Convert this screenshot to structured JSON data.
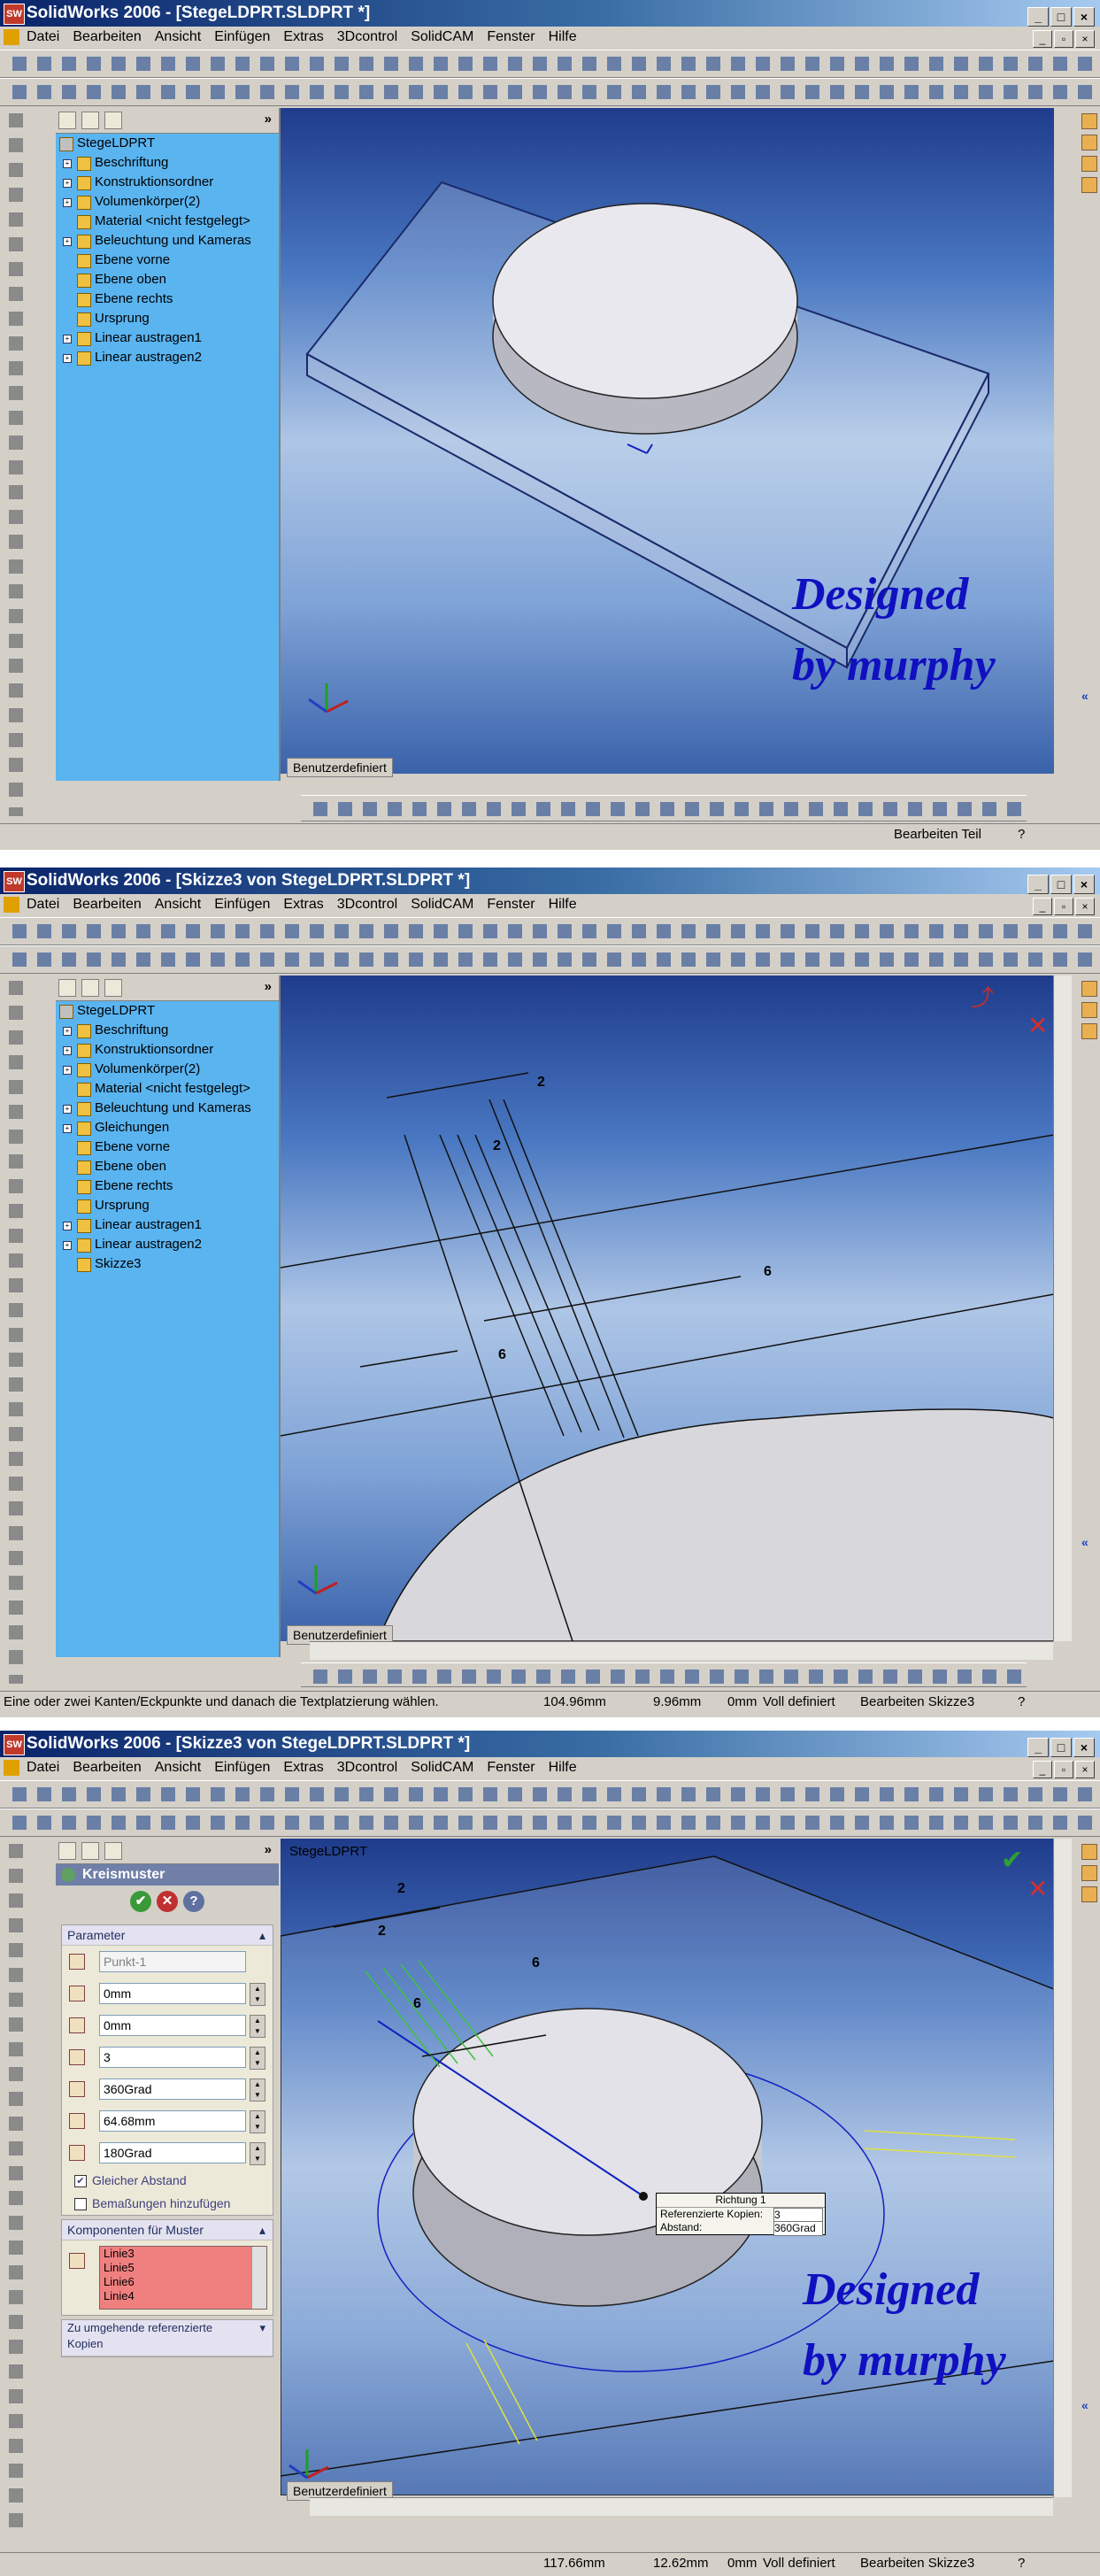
{
  "windows": [
    {
      "title": "SolidWorks 2006 - [StegeLDPRT.SLDPRT *]",
      "status": {
        "text": "",
        "coords": [],
        "state": "",
        "edit": "Bearbeiten Teil"
      }
    },
    {
      "title": "SolidWorks 2006 - [Skizze3 von StegeLDPRT.SLDPRT *]",
      "status": {
        "text": "Eine oder zwei Kanten/Eckpunkte und danach die Textplatzierung wählen.",
        "coords": [
          "104.96mm",
          "9.96mm",
          "0mm"
        ],
        "state": "Voll definiert",
        "edit": "Bearbeiten Skizze3"
      }
    },
    {
      "title": "SolidWorks 2006 - [Skizze3 von StegeLDPRT.SLDPRT *]",
      "status": {
        "text": "",
        "coords": [
          "117.66mm",
          "12.62mm",
          "0mm"
        ],
        "state": "Voll definiert",
        "edit": "Bearbeiten Skizze3"
      }
    }
  ],
  "menu": [
    "Datei",
    "Bearbeiten",
    "Ansicht",
    "Einfügen",
    "Extras",
    "3Dcontrol",
    "SolidCAM",
    "Fenster",
    "Hilfe"
  ],
  "tree1": {
    "root": "StegeLDPRT",
    "items": [
      "Beschriftung",
      "Konstruktionsordner",
      "Volumenkörper(2)",
      "Material <nicht festgelegt>",
      "Beleuchtung und Kameras",
      "Ebene vorne",
      "Ebene oben",
      "Ebene rechts",
      "Ursprung",
      "Linear austragen1",
      "Linear austragen2"
    ]
  },
  "tree2": {
    "root": "StegeLDPRT",
    "items": [
      "Beschriftung",
      "Konstruktionsordner",
      "Volumenkörper(2)",
      "Material <nicht festgelegt>",
      "Beleuchtung und Kameras",
      "Gleichungen",
      "Ebene vorne",
      "Ebene oben",
      "Ebene rechts",
      "Ursprung",
      "Linear austragen1",
      "Linear austragen2",
      "Skizze3"
    ]
  },
  "view_tab": "Benutzerdefiniert",
  "watermark": {
    "line1": "Designed",
    "line2": "by murphy"
  },
  "dims2": [
    "2",
    "2",
    "6",
    "6"
  ],
  "dims3": [
    "2",
    "2",
    "6",
    "6"
  ],
  "viewport3_label": "StegeLDPRT",
  "property_manager": {
    "title": "Kreismuster",
    "group_params": "Parameter",
    "point": "Punkt-1",
    "fields": [
      "0mm",
      "0mm",
      "3",
      "360Grad",
      "64.68mm",
      "180Grad"
    ],
    "check_equal": "Gleicher Abstand",
    "check_dims": "Bemaßungen hinzufügen",
    "group_components": "Komponenten für Muster",
    "list": [
      "Linie3",
      "Linie5",
      "Linie6",
      "Linie4"
    ],
    "group_ref": "Zu umgehende referenzierte Kopien"
  },
  "callout": {
    "title": "Richtung 1",
    "row1_label": "Referenzierte Kopien:",
    "row1_value": "3",
    "row2_label": "Abstand:",
    "row2_value": "360Grad"
  }
}
